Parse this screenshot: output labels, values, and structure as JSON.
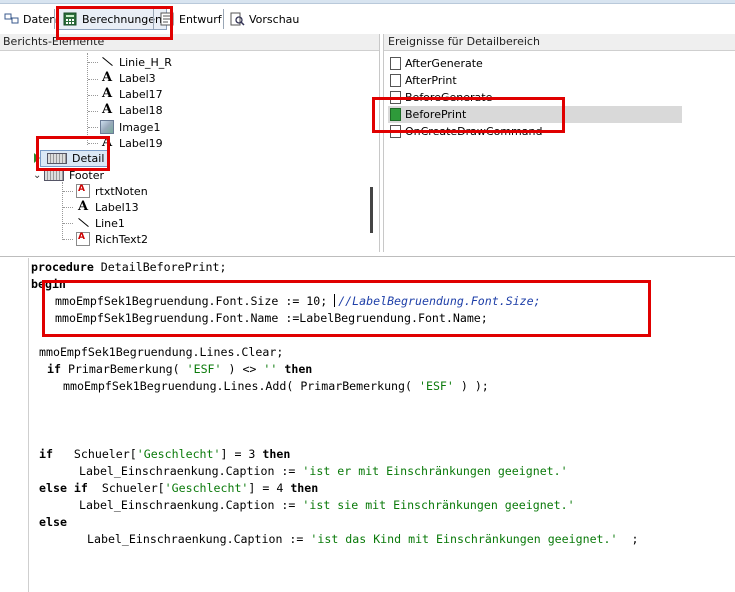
{
  "tabs": [
    {
      "label": "Daten",
      "icon": "data-icon"
    },
    {
      "label": "Berechnungen",
      "icon": "calculator-icon"
    },
    {
      "label": "Entwurf",
      "icon": "design-icon"
    },
    {
      "label": "Vorschau",
      "icon": "preview-icon"
    }
  ],
  "left_panel": {
    "title": "Berichts-Elemente",
    "items": [
      {
        "label": "Linie_H_R",
        "icon": "line-icon"
      },
      {
        "label": "Label3",
        "icon": "label-icon"
      },
      {
        "label": "Label17",
        "icon": "label-icon"
      },
      {
        "label": "Label18",
        "icon": "label-icon"
      },
      {
        "label": "Image1",
        "icon": "image-icon"
      },
      {
        "label": "Label19",
        "icon": "label-icon"
      },
      {
        "label": "Detail",
        "icon": "band-icon"
      },
      {
        "label": "Footer",
        "icon": "band-icon"
      },
      {
        "label": "rtxtNoten",
        "icon": "richtext-icon"
      },
      {
        "label": "Label13",
        "icon": "label-icon"
      },
      {
        "label": "Line1",
        "icon": "line-icon"
      },
      {
        "label": "RichText2",
        "icon": "richtext-icon"
      }
    ]
  },
  "right_panel": {
    "title": "Ereignisse für Detailbereich",
    "events": [
      "AfterGenerate",
      "AfterPrint",
      "BeforeGenerate",
      "BeforePrint",
      "OnCreateDrawCommand"
    ],
    "selected": "BeforePrint"
  },
  "code": {
    "l1_kw": "procedure",
    "l1_rest": " DetailBeforePrint;",
    "l2_kw": "begin",
    "l3_code": "mmoEmpfSek1Begruendung.Font.Size := 10; ",
    "l3_cmt": "//LabelBegruendung.Font.Size;",
    "l4_code": "mmoEmpfSek1Begruendung.Font.Name :=LabelBegruendung.Font.Name;",
    "l5_code": "mmoEmpfSek1Begruendung.Lines.Clear;",
    "l6_kw1": "if",
    "l6_a": " PrimarBemerkung( ",
    "l6_s1": "'ESF'",
    "l6_b": " ) <> ",
    "l6_s2": "''",
    "l6_c": " ",
    "l6_kw2": "then",
    "l7_a": "mmoEmpfSek1Begruendung.Lines.Add( PrimarBemerkung( ",
    "l7_s": "'ESF'",
    "l7_b": " ) );",
    "l8_kw1": "if",
    "l8_a": "   Schueler[",
    "l8_s": "'Geschlecht'",
    "l8_b": "] = 3 ",
    "l8_kw2": "then",
    "l9_a": "Label_Einschraenkung.Caption := ",
    "l9_s": "'ist er mit Einschränkungen geeignet.'",
    "l10_kw1": "else if",
    "l10_a": "  Schueler[",
    "l10_s": "'Geschlecht'",
    "l10_b": "] = 4 ",
    "l10_kw2": "then",
    "l11_a": "Label_Einschraenkung.Caption := ",
    "l11_s": "'ist sie mit Einschränkungen geeignet.'",
    "l12_kw": "else",
    "l13_a": "Label_Einschraenkung.Caption := ",
    "l13_s": "'ist das Kind mit Einschränkungen geeignet.'",
    "l13_b": "  ;"
  },
  "colors": {
    "highlight": "#e00000",
    "string": "#0a7a0a",
    "comment": "#1e3fa8"
  }
}
